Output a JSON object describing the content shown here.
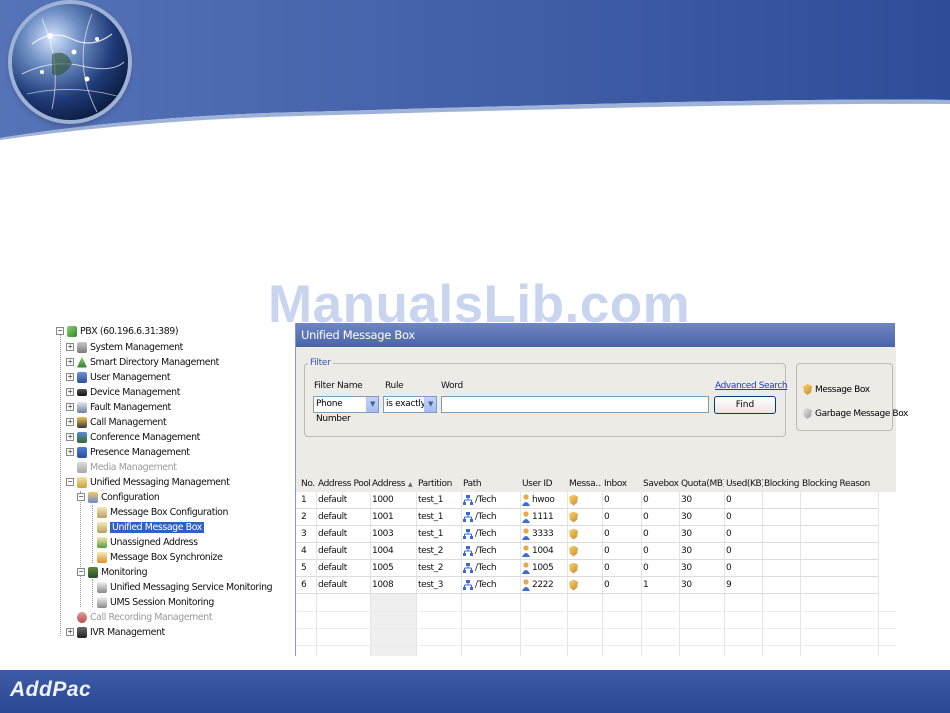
{
  "watermark": "ManualsLib.com",
  "brand": "AddPac",
  "colors": {
    "header_blue": "#4a64aa",
    "banner_blue": "#3d5aa7",
    "selection": "#3060c0",
    "link": "#1a3fd0"
  },
  "tree": {
    "root": "PBX (60.196.6.31:389)",
    "items": [
      {
        "label": "System Management",
        "icon": "server-icon"
      },
      {
        "label": "Smart Directory Management",
        "icon": "directory-icon"
      },
      {
        "label": "User Management",
        "icon": "users-icon"
      },
      {
        "label": "Device Management",
        "icon": "device-icon"
      },
      {
        "label": "Fault Management",
        "icon": "fault-icon"
      },
      {
        "label": "Call Management",
        "icon": "call-icon"
      },
      {
        "label": "Conference Management",
        "icon": "conference-icon"
      },
      {
        "label": "Presence Management",
        "icon": "presence-icon"
      },
      {
        "label": "Media Management",
        "icon": "media-icon"
      },
      {
        "label": "Unified Messaging Management",
        "icon": "messaging-icon"
      },
      {
        "label": "Configuration",
        "icon": "config-icon"
      },
      {
        "label": "Message Box Configuration",
        "icon": "mailbox-config-icon"
      },
      {
        "label": "Unified Message Box",
        "icon": "message-box-icon"
      },
      {
        "label": "Unassigned Address",
        "icon": "address-icon"
      },
      {
        "label": "Message Box Synchronize",
        "icon": "sync-icon"
      },
      {
        "label": "Monitoring",
        "icon": "monitor-icon"
      },
      {
        "label": "Unified Messaging Service Monitoring",
        "icon": "service-monitor-icon"
      },
      {
        "label": "UMS Session Monitoring",
        "icon": "session-monitor-icon"
      },
      {
        "label": "Call Recording Management",
        "icon": "recording-icon"
      },
      {
        "label": "IVR Management",
        "icon": "ivr-icon"
      }
    ]
  },
  "panel": {
    "title": "Unified Message Box",
    "filter": {
      "legend": "Filter",
      "filter_name_label": "Filter Name",
      "rule_label": "Rule",
      "word_label": "Word",
      "filter_name_value": "Phone Number",
      "rule_value": "is exactly",
      "word_value": "",
      "advanced_search": "Advanced Search",
      "find_button": "Find"
    },
    "box_types": {
      "message_box": "Message Box",
      "garbage_box": "Garbage Message Box"
    },
    "table": {
      "columns": [
        "No.",
        "Address Pool",
        "Address",
        "Partition",
        "Path",
        "User ID",
        "Messa…",
        "Inbox",
        "Savebox",
        "Quota(MB)",
        "Used(KB)",
        "Blocking",
        "Blocking Reason"
      ],
      "rows": [
        [
          "1",
          "default",
          "1000",
          "test_1",
          "/Tech",
          "hwoo",
          "",
          "0",
          "0",
          "30",
          "0",
          "",
          ""
        ],
        [
          "2",
          "default",
          "1001",
          "test_1",
          "/Tech",
          "1111",
          "",
          "0",
          "0",
          "30",
          "0",
          "",
          ""
        ],
        [
          "3",
          "default",
          "1003",
          "test_1",
          "/Tech",
          "3333",
          "",
          "0",
          "0",
          "30",
          "0",
          "",
          ""
        ],
        [
          "4",
          "default",
          "1004",
          "test_2",
          "/Tech",
          "1004",
          "",
          "0",
          "0",
          "30",
          "0",
          "",
          ""
        ],
        [
          "5",
          "default",
          "1005",
          "test_2",
          "/Tech",
          "1005",
          "",
          "0",
          "0",
          "30",
          "0",
          "",
          ""
        ],
        [
          "6",
          "default",
          "1008",
          "test_3",
          "/Tech",
          "2222",
          "",
          "0",
          "1",
          "30",
          "9",
          "",
          ""
        ]
      ]
    }
  }
}
